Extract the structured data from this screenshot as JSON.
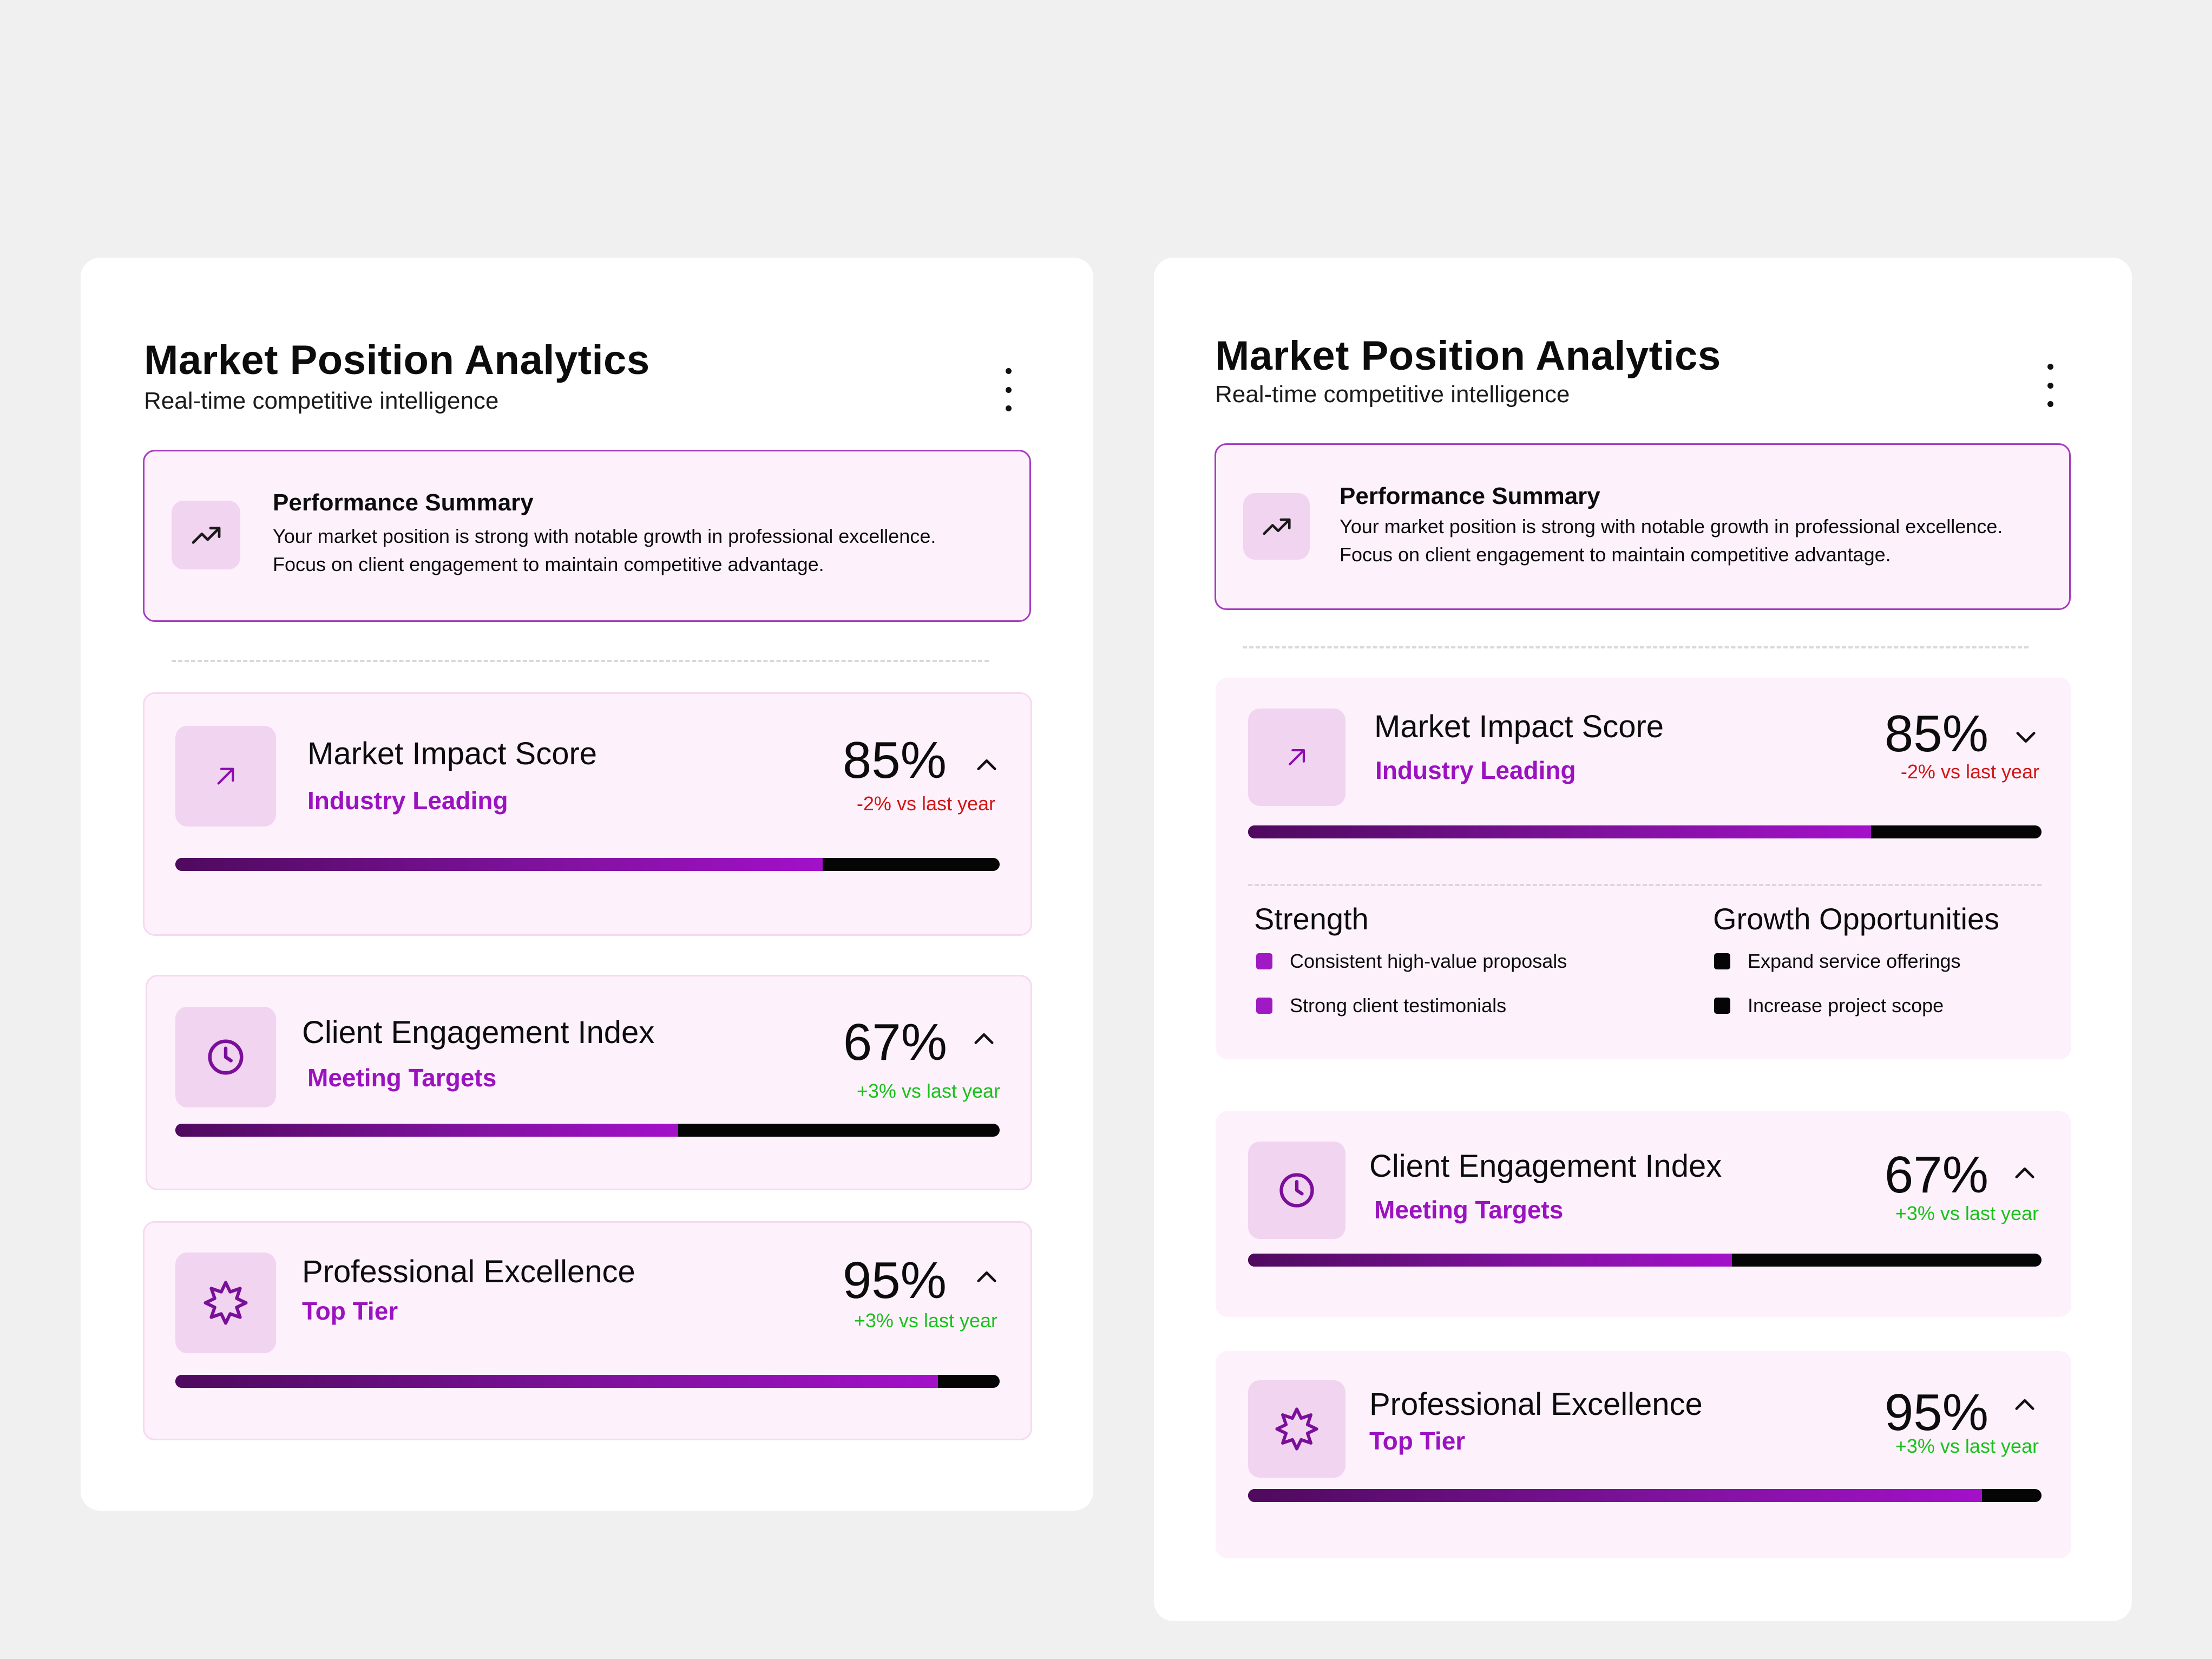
{
  "panels": [
    {
      "title": "Market Position Analytics",
      "subtitle": "Real-time competitive intelligence",
      "summary": {
        "icon": "trending-up-icon",
        "heading": "Performance Summary",
        "line1": "Your market position is strong with notable growth in professional excellence.",
        "line2": "Focus on client engagement to maintain competitive advantage."
      },
      "metrics": [
        {
          "name": "Market Impact Score",
          "status": "Industry Leading",
          "value": "85%",
          "delta": "-2% vs last year",
          "icon": "arrow-up-right-icon",
          "chevron": "chevron-up-icon",
          "progress": 0.785
        },
        {
          "name": "Client Engagement Index",
          "status": "Meeting Targets",
          "value": "67%",
          "delta": "+3% vs last year",
          "icon": "clock-icon",
          "chevron": "chevron-up-icon",
          "progress": 0.61
        },
        {
          "name": "Professional Excellence",
          "status": "Top Tier",
          "value": "95%",
          "delta": "+3% vs last year",
          "icon": "badge-star-icon",
          "chevron": "chevron-up-icon",
          "progress": 0.925
        }
      ]
    },
    {
      "title": "Market Position Analytics",
      "subtitle": "Real-time competitive intelligence",
      "summary": {
        "icon": "trending-up-icon",
        "heading": "Performance Summary",
        "line1": "Your market position is strong with notable growth in professional excellence.",
        "line2": "Focus on client engagement to maintain competitive advantage."
      },
      "metrics": [
        {
          "name": "Market Impact Score",
          "status": "Industry Leading",
          "value": "85%",
          "delta": "-2% vs last year",
          "icon": "arrow-up-right-icon",
          "chevron": "chevron-down-icon",
          "progress": 0.785,
          "expanded": {
            "strength_title": "Strength",
            "strengths": [
              "Consistent high-value proposals",
              "Strong client testimonials"
            ],
            "growth_title": "Growth Opportunities",
            "growth": [
              "Expand service offerings",
              "Increase project scope"
            ]
          }
        },
        {
          "name": "Client Engagement Index",
          "status": "Meeting Targets",
          "value": "67%",
          "delta": "+3% vs last year",
          "icon": "clock-icon",
          "chevron": "chevron-up-icon",
          "progress": 0.61
        },
        {
          "name": "Professional Excellence",
          "status": "Top Tier",
          "value": "95%",
          "delta": "+3% vs last year",
          "icon": "badge-star-icon",
          "chevron": "chevron-up-icon",
          "progress": 0.925
        }
      ]
    }
  ],
  "colors": {
    "accent": "#9b12c0",
    "negative": "#d21414",
    "positive": "#18c21a",
    "card_bg": "#fdf1fb",
    "icon_tile": "#f1d4f0"
  }
}
